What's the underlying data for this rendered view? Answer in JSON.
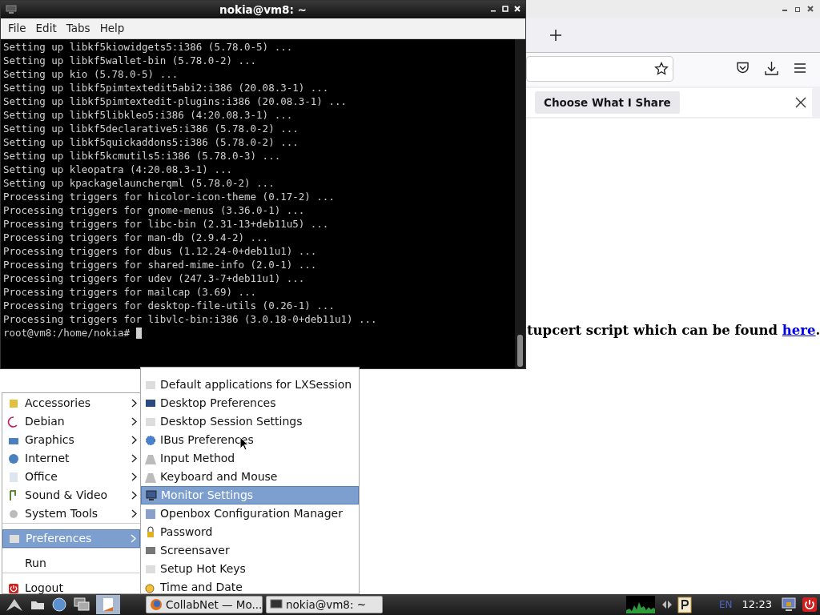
{
  "browser": {
    "notification": {
      "button": "Choose What I Share"
    },
    "content_text": "tupcert script which can be found ",
    "content_link": "here",
    "content_end": "."
  },
  "terminal": {
    "title": "nokia@vm8: ~",
    "menu": [
      "File",
      "Edit",
      "Tabs",
      "Help"
    ],
    "lines": [
      "Setting up libkf5kiowidgets5:i386 (5.78.0-5) ...",
      "Setting up libkf5wallet-bin (5.78.0-2) ...",
      "Setting up kio (5.78.0-5) ...",
      "Setting up libkf5pimtextedit5abi2:i386 (20.08.3-1) ...",
      "Setting up libkf5pimtextedit-plugins:i386 (20.08.3-1) ...",
      "Setting up libkf5libkleo5:i386 (4:20.08.3-1) ...",
      "Setting up libkf5declarative5:i386 (5.78.0-2) ...",
      "Setting up libkf5quickaddons5:i386 (5.78.0-2) ...",
      "Setting up libkf5kcmutils5:i386 (5.78.0-3) ...",
      "Setting up kleopatra (4:20.08.3-1) ...",
      "Setting up kpackagelauncherqml (5.78.0-2) ...",
      "Processing triggers for hicolor-icon-theme (0.17-2) ...",
      "Processing triggers for gnome-menus (3.36.0-1) ...",
      "Processing triggers for libc-bin (2.31-13+deb11u5) ...",
      "Processing triggers for man-db (2.9.4-2) ...",
      "Processing triggers for dbus (1.12.24-0+deb11u1) ...",
      "Processing triggers for shared-mime-info (2.0-1) ...",
      "Processing triggers for udev (247.3-7+deb11u1) ...",
      "Processing triggers for mailcap (3.69) ...",
      "Processing triggers for desktop-file-utils (0.26-1) ...",
      "Processing triggers for libvlc-bin:i386 (3.0.18-0+deb11u1) ..."
    ],
    "prompt": "root@vm8:/home/nokia#"
  },
  "main_menu": [
    {
      "label": "Accessories",
      "kind": "submenu",
      "selected": false
    },
    {
      "label": "Debian",
      "kind": "submenu",
      "selected": false
    },
    {
      "label": "Graphics",
      "kind": "submenu",
      "selected": false
    },
    {
      "label": "Internet",
      "kind": "submenu",
      "selected": false
    },
    {
      "label": "Office",
      "kind": "submenu",
      "selected": false
    },
    {
      "label": "Sound & Video",
      "kind": "submenu",
      "selected": false
    },
    {
      "label": "System Tools",
      "kind": "submenu",
      "selected": false
    },
    {
      "kind": "separator"
    },
    {
      "label": "Preferences",
      "kind": "submenu",
      "selected": true
    },
    {
      "kind": "separator"
    },
    {
      "label": "Run",
      "kind": "item",
      "selected": false
    },
    {
      "kind": "separator"
    },
    {
      "label": "Logout",
      "kind": "item",
      "selected": false
    }
  ],
  "submenu": [
    {
      "label": "Default applications for LXSession",
      "selected": false
    },
    {
      "label": "Desktop Preferences",
      "selected": false
    },
    {
      "label": "Desktop Session Settings",
      "selected": false
    },
    {
      "label": "IBus Preferences",
      "selected": false
    },
    {
      "label": "Input Method",
      "selected": false
    },
    {
      "label": "Keyboard and Mouse",
      "selected": false
    },
    {
      "label": "Monitor Settings",
      "selected": true
    },
    {
      "label": "Openbox Configuration Manager",
      "selected": false
    },
    {
      "label": "Password",
      "selected": false
    },
    {
      "label": "Screensaver",
      "selected": false
    },
    {
      "label": "Setup Hot Keys",
      "selected": false
    },
    {
      "label": "Time and Date",
      "selected": false
    }
  ],
  "taskbar": {
    "tasks": [
      {
        "label": "CollabNet — Mo...",
        "selected": false
      },
      {
        "label": "nokia@vm8: ~",
        "selected": false
      }
    ],
    "keyboard_layout": "EN",
    "clock": "12:23"
  }
}
